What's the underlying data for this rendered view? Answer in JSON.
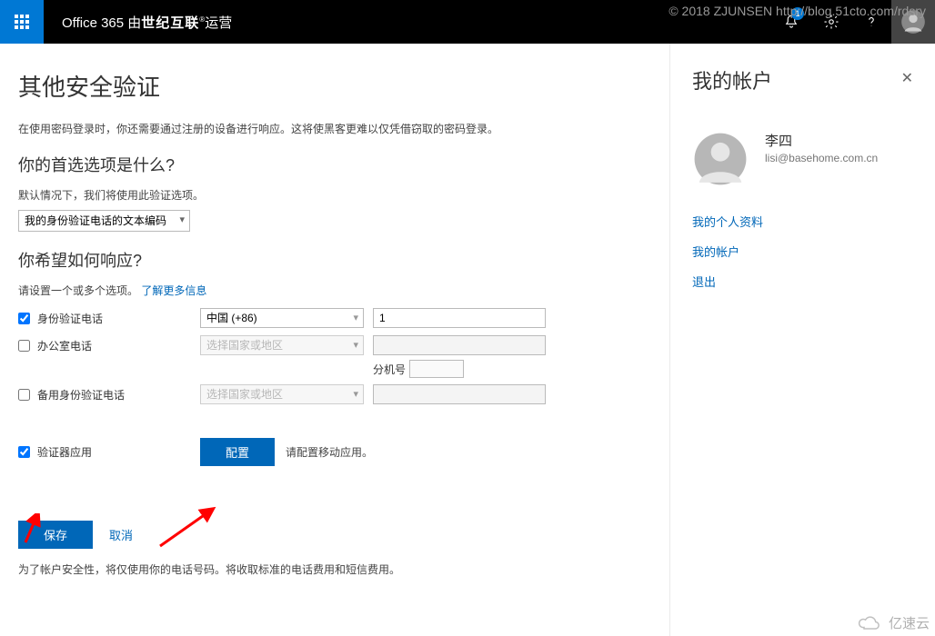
{
  "watermark": "© 2018 ZJUNSEN http://blog.51cto.com/rdsry",
  "topbar": {
    "brand_prefix": "Office 365 由",
    "brand_bold": "世纪互联",
    "brand_suffix": "运营",
    "notif_badge": "1"
  },
  "main": {
    "title": "其他安全验证",
    "intro": "在使用密码登录时，你还需要通过注册的设备进行响应。这将使黑客更难以仅凭借窃取的密码登录。",
    "q1": "你的首选选项是什么?",
    "q1_desc": "默认情况下，我们将使用此验证选项。",
    "pref_option": "我的身份验证电话的文本编码",
    "q2": "你希望如何响应?",
    "q2_desc_a": "请设置一个或多个选项。",
    "q2_link": "了解更多信息",
    "opt_auth_phone": "身份验证电话",
    "opt_office_phone": "办公室电话",
    "opt_alt_phone": "备用身份验证电话",
    "opt_authenticator": "验证器应用",
    "country_china": "中国 (+86)",
    "country_placeholder": "选择国家或地区",
    "phone_value": "1",
    "ext_label": "分机号",
    "config_btn": "配置",
    "config_note": "请配置移动应用。",
    "save_btn": "保存",
    "cancel": "取消",
    "footnote": "为了帐户安全性，将仅使用你的电话号码。将收取标准的电话费用和短信费用。"
  },
  "side": {
    "title": "我的帐户",
    "user_name": "李四",
    "user_email": "lisi@basehome.com.cn",
    "link_profile": "我的个人资料",
    "link_account": "我的帐户",
    "link_signout": "退出"
  },
  "corner_brand": "亿速云"
}
